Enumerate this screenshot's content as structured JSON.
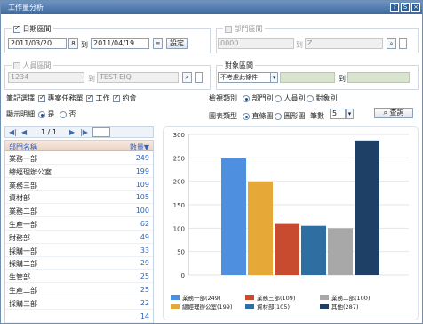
{
  "window": {
    "title": "工作量分析",
    "help_label": "?",
    "export_label": "S",
    "close_label": "×"
  },
  "date_range": {
    "legend": "日期區間",
    "enabled": true,
    "start": "2011/03/20",
    "to_label": "到",
    "end": "2011/04/19",
    "set_label": "設定"
  },
  "department_range": {
    "legend": "部門區間",
    "enabled": false,
    "from": "0000",
    "to_label": "到",
    "to": "Z"
  },
  "person_range": {
    "legend": "人員區間",
    "enabled": false,
    "from": "1234",
    "to_label": "到",
    "to": "TEST-EIQ"
  },
  "target_range": {
    "legend": "對象區間",
    "condition": "不考慮此條件",
    "to_label": "到"
  },
  "stats_options": {
    "label": "筆記選擇",
    "items": [
      {
        "label": "專案任務單",
        "checked": true
      },
      {
        "label": "工作",
        "checked": true
      },
      {
        "label": "約會",
        "checked": true
      }
    ]
  },
  "show_detail": {
    "label": "顯示明細",
    "yes": "是",
    "no": "否",
    "selected": "yes"
  },
  "category": {
    "label": "檢視類別",
    "options": [
      "部門別",
      "人員別",
      "對象別"
    ],
    "selected": 0
  },
  "chart_type": {
    "label": "圖表類型",
    "options": [
      "直條圖",
      "圓形圖"
    ],
    "selected": 0,
    "count_label": "筆數",
    "count": "5"
  },
  "query_button": "查詢",
  "pager": {
    "first": "◀|",
    "prev": "◀",
    "text": "1 / 1",
    "next": "▶",
    "last": "|▶"
  },
  "table": {
    "col_name": "部門名稱",
    "col_count": "數量▼",
    "rows": [
      {
        "name": "業務一部",
        "count": "249"
      },
      {
        "name": "總經理辦公室",
        "count": "199"
      },
      {
        "name": "業務三部",
        "count": "109"
      },
      {
        "name": "資材部",
        "count": "105"
      },
      {
        "name": "業務二部",
        "count": "100"
      },
      {
        "name": "生產一部",
        "count": "62"
      },
      {
        "name": "財務部",
        "count": "49"
      },
      {
        "name": "採購一部",
        "count": "33"
      },
      {
        "name": "採購二部",
        "count": "29"
      },
      {
        "name": "生管部",
        "count": "25"
      },
      {
        "name": "生產二部",
        "count": "25"
      },
      {
        "name": "採購三部",
        "count": "22"
      },
      {
        "name": "",
        "count": "14"
      }
    ]
  },
  "chart_data": {
    "type": "bar",
    "categories": [
      "業務一部",
      "總經理辦公室",
      "業務三部",
      "資材部",
      "業務二部",
      "其他"
    ],
    "values": [
      249,
      199,
      109,
      105,
      100,
      287
    ],
    "ylim": [
      0,
      300
    ],
    "yticks": [
      "0",
      "50",
      "100",
      "150",
      "200",
      "250",
      "300"
    ],
    "colors": [
      "#4f8fe0",
      "#e6a938",
      "#c84b2f",
      "#2f6ea0",
      "#a8a8a8",
      "#1e3f66"
    ],
    "legend": [
      {
        "label": "業務一部(249)",
        "color": "#4f8fe0"
      },
      {
        "label": "業務三部(109)",
        "color": "#c84b2f"
      },
      {
        "label": "業務二部(100)",
        "color": "#a8a8a8"
      },
      {
        "label": "總經理辦公室(199)",
        "color": "#e6a938"
      },
      {
        "label": "資材部(105)",
        "color": "#2f6ea0"
      },
      {
        "label": "其他(287)",
        "color": "#1e3f66"
      }
    ]
  }
}
